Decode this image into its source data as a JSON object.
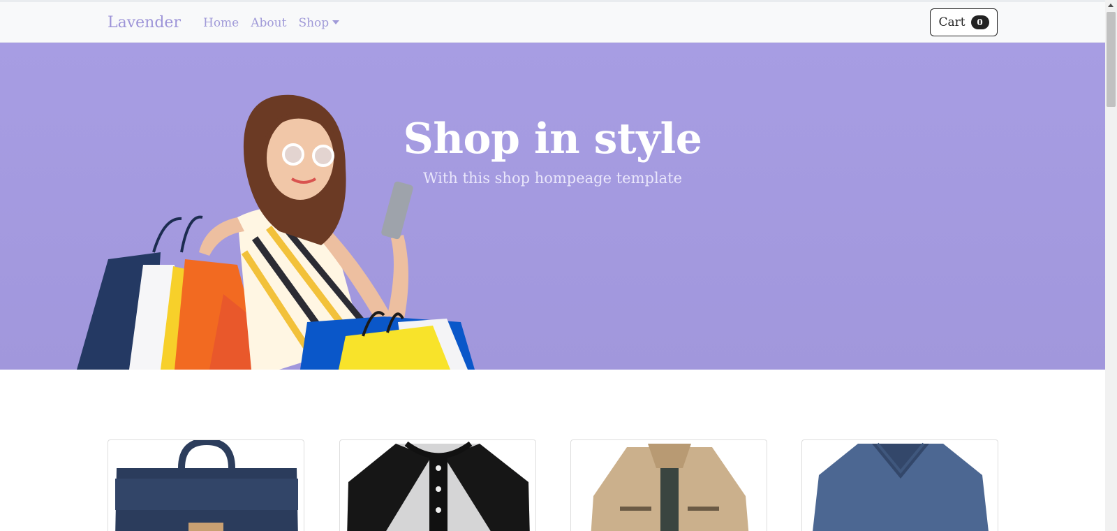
{
  "navbar": {
    "brand": "Lavender",
    "links": [
      "Home",
      "About",
      "Shop"
    ],
    "cart_label": "Cart",
    "cart_count": "0"
  },
  "hero": {
    "title": "Shop in style",
    "subtitle": "With this shop hompeage template"
  },
  "products": [
    {
      "icon": "backpack-image"
    },
    {
      "icon": "raglan-shirt-image"
    },
    {
      "icon": "jacket-image"
    },
    {
      "icon": "sweater-image"
    }
  ],
  "colors": {
    "accent": "#a79de3",
    "brand_text": "#9d94d8"
  }
}
